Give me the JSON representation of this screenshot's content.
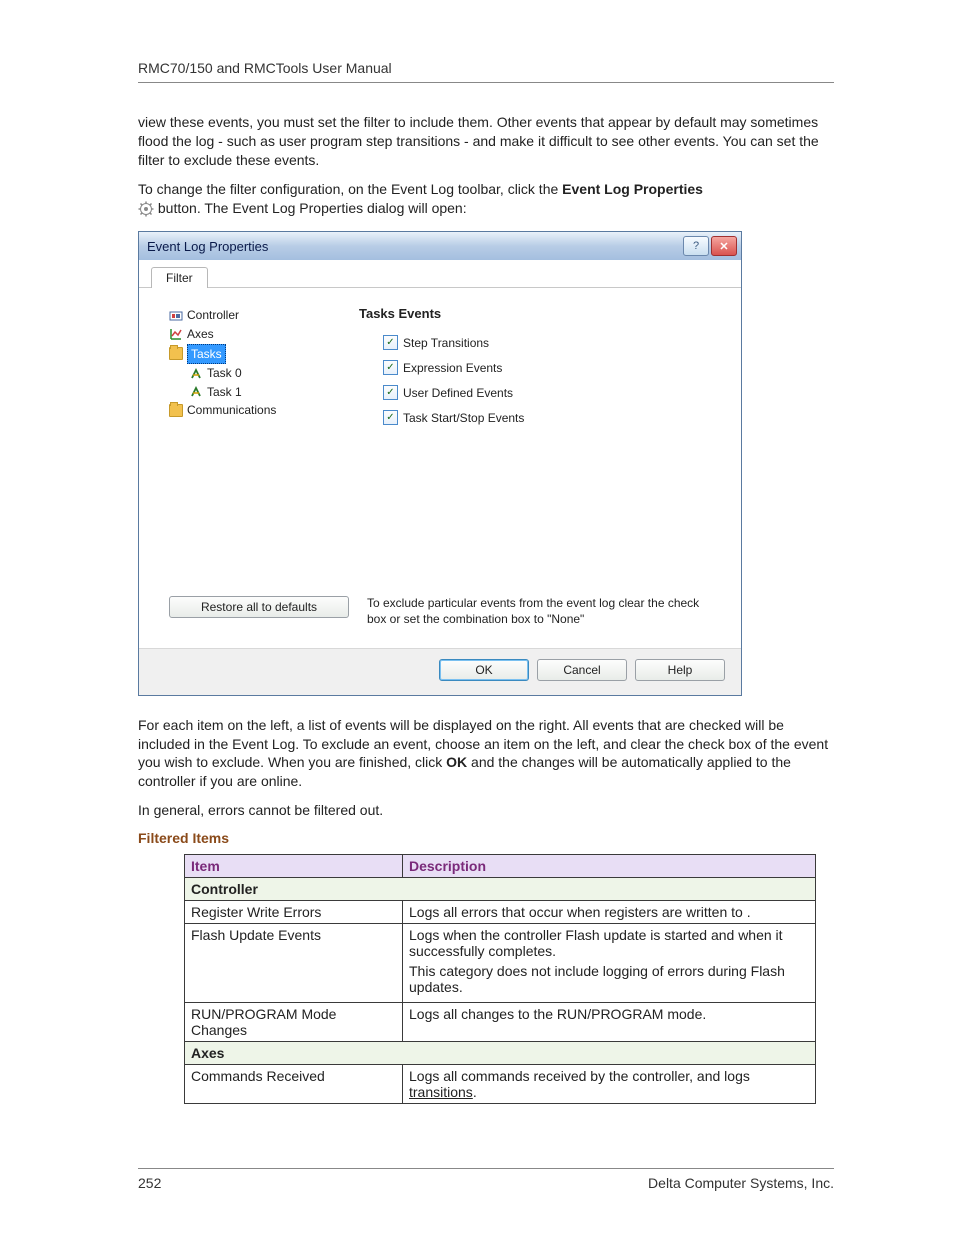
{
  "header": {
    "title": "RMC70/150 and RMCTools User Manual"
  },
  "body": {
    "p1": "view these events, you must set the filter to include them. Other events that appear by default may sometimes flood the log - such as user program step transitions - and make it difficult to see other events. You can set the filter to exclude these events.",
    "p2a": "To change the filter configuration, on the Event Log toolbar, click the ",
    "p2b_bold": "Event Log Properties",
    "p2c": " button. The Event Log Properties dialog will open:",
    "p3a": "For each item on the left, a list of events will be displayed on the right. All events that are checked will be included in the Event Log. To exclude an event, choose an item on the left, and clear the check box of the event you wish to exclude. When you are finished, click ",
    "p3b_bold": "OK",
    "p3c": " and the changes will be automatically applied to the controller if you are online.",
    "p4": "In general, errors cannot be filtered out.",
    "section_heading": "Filtered Items"
  },
  "dialog": {
    "title": "Event Log Properties",
    "tab": "Filter",
    "tree": {
      "controller": "Controller",
      "axes": "Axes",
      "tasks": "Tasks",
      "task0": "Task 0",
      "task1": "Task 1",
      "comm": "Communications"
    },
    "right": {
      "heading": "Tasks Events",
      "checks": {
        "step": "Step Transitions",
        "expr": "Expression Events",
        "udef": "User Defined Events",
        "startstop": "Task Start/Stop Events"
      }
    },
    "restore": "Restore all to defaults",
    "hint": "To exclude particular events from the event log clear the check box or set the combination box to \"None\"",
    "buttons": {
      "ok": "OK",
      "cancel": "Cancel",
      "help": "Help"
    }
  },
  "table": {
    "head": {
      "item": "Item",
      "desc": "Description"
    },
    "groups": {
      "controller": "Controller",
      "axes": "Axes"
    },
    "rows": {
      "reg_item": "Register Write Errors",
      "reg_desc": "Logs all errors that occur when registers are written to .",
      "flash_item": "Flash Update Events",
      "flash_desc1": "Logs when the controller Flash update is started and when it successfully completes.",
      "flash_desc2": "This category does not include logging of errors during Flash updates.",
      "mode_item": "RUN/PROGRAM Mode Changes",
      "mode_desc": "Logs all changes to the RUN/PROGRAM mode.",
      "cmd_item": "Commands Received",
      "cmd_desc_a": "Logs all commands received by the controller, and logs ",
      "cmd_desc_b": "transitions",
      "cmd_desc_c": "."
    }
  },
  "footer": {
    "page": "252",
    "company": "Delta Computer Systems, Inc."
  }
}
